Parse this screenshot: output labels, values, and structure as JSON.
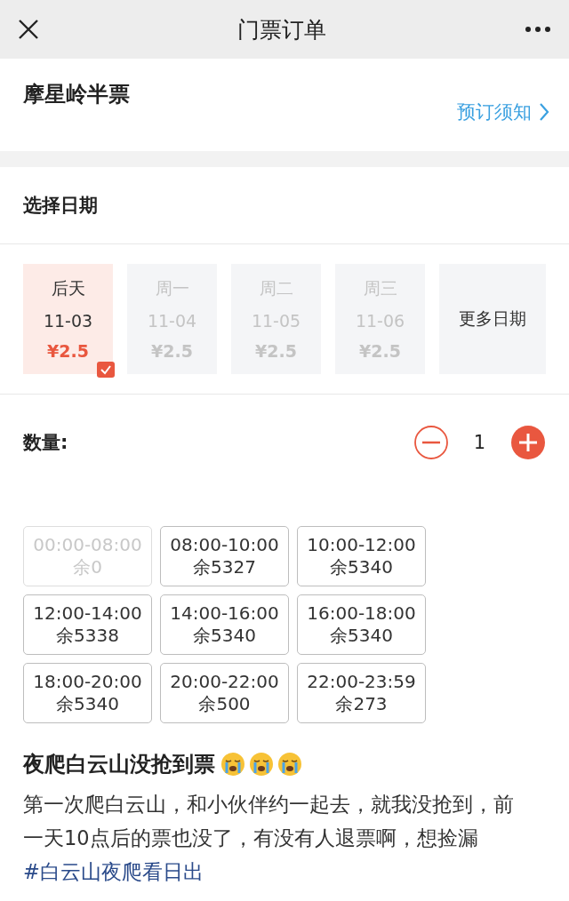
{
  "nav": {
    "title": "门票订单"
  },
  "ticket": {
    "name": "摩星岭半票",
    "notice_link": "预订须知"
  },
  "date_section": {
    "heading": "选择日期",
    "dates": [
      {
        "kind": "date",
        "weekday": "后天",
        "date": "11-03",
        "price": "¥2.5",
        "selected": true
      },
      {
        "kind": "date",
        "weekday": "周一",
        "date": "11-04",
        "price": "¥2.5",
        "selected": false
      },
      {
        "kind": "date",
        "weekday": "周二",
        "date": "11-05",
        "price": "¥2.5",
        "selected": false
      },
      {
        "kind": "date",
        "weekday": "周三",
        "date": "11-06",
        "price": "¥2.5",
        "selected": false
      },
      {
        "kind": "more",
        "label": "更多日期"
      }
    ]
  },
  "quantity": {
    "label": "数量:",
    "value": "1"
  },
  "time_slots": [
    {
      "time": "00:00-08:00",
      "remaining": "余0",
      "disabled": true
    },
    {
      "time": "08:00-10:00",
      "remaining": "余5327",
      "disabled": false
    },
    {
      "time": "10:00-12:00",
      "remaining": "余5340",
      "disabled": false
    },
    {
      "time": "12:00-14:00",
      "remaining": "余5338",
      "disabled": false
    },
    {
      "time": "14:00-16:00",
      "remaining": "余5340",
      "disabled": false
    },
    {
      "time": "16:00-18:00",
      "remaining": "余5340",
      "disabled": false
    },
    {
      "time": "18:00-20:00",
      "remaining": "余5340",
      "disabled": false
    },
    {
      "time": "20:00-22:00",
      "remaining": "余500",
      "disabled": false
    },
    {
      "time": "22:00-23:59",
      "remaining": "余273",
      "disabled": false
    }
  ],
  "post": {
    "title": "夜爬白云山没抢到票",
    "emojis": [
      {
        "kind": "crying"
      },
      {
        "kind": "crying"
      },
      {
        "kind": "crying"
      }
    ],
    "body": "第一次爬白云山，和小伙伴约一起去，就我没抢到，前一天10点后的票也没了，有没有人退票啊，想捡漏 ",
    "hashtag": "#白云山夜爬看日出"
  }
}
